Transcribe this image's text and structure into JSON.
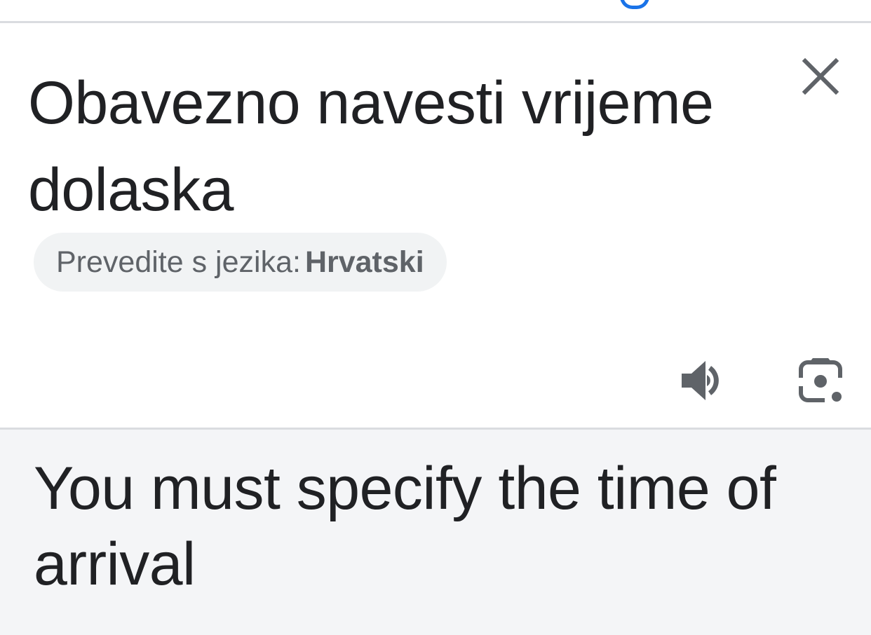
{
  "source": {
    "text": "Obavezno navesti vrijeme dolaska",
    "detected_prefix": "Prevedite s jezika:",
    "detected_language": "Hrvatski",
    "close_icon": "close-icon",
    "speaker_icon": "speaker-icon",
    "lens_icon": "camera-lens-icon"
  },
  "translation": {
    "text": "You must specify the time of arrival"
  },
  "colors": {
    "accent": "#1a73e8",
    "icon": "#5f6368",
    "text": "#202124",
    "target_background": "#f4f5f7",
    "chip_background": "#f1f3f4",
    "divider": "#dadce0"
  }
}
